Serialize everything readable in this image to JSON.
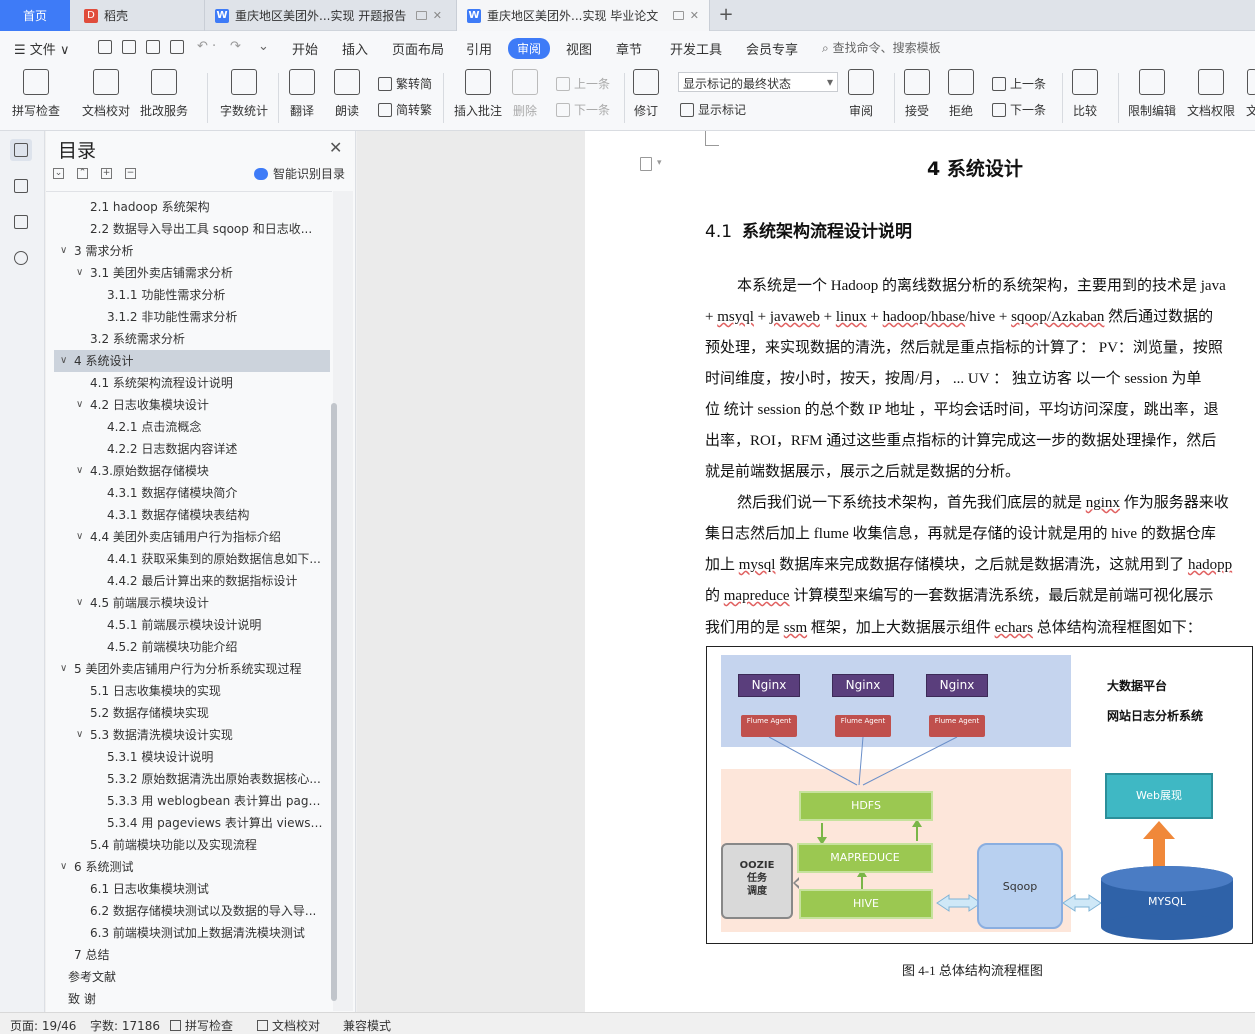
{
  "tabs": {
    "home": "首页",
    "t1": "稻壳",
    "t2": "重庆地区美团外...实现 开题报告",
    "t3": "重庆地区美团外...实现 毕业论文",
    "add": "+"
  },
  "menu": {
    "file": "文件",
    "items": [
      "开始",
      "插入",
      "页面布局",
      "引用",
      "审阅",
      "视图",
      "章节",
      "开发工具",
      "会员专享"
    ],
    "search": "查找命令、搜索模板"
  },
  "ribbon": {
    "spell": "拼写检查",
    "proof": "文档校对",
    "batch": "批改服务",
    "wordcount": "字数统计",
    "translate": "翻译",
    "read": "朗读",
    "trad2simp": "繁转简",
    "simp2trad": "简转繁",
    "insert_comment": "插入批注",
    "delete": "删除",
    "prev1": "上一条",
    "next1": "下一条",
    "track": "修订",
    "markup_state": "显示标记的最终状态",
    "show_markup": "显示标记",
    "review": "审阅",
    "accept": "接受",
    "reject": "拒绝",
    "prev2": "上一条",
    "next2": "下一条",
    "compare": "比较",
    "restrict": "限制编辑",
    "perm": "文档权限",
    "cut": "文"
  },
  "nav": {
    "title": "目录",
    "smart": "智能识别目录",
    "items": [
      {
        "label": "2.1 hadoop 系统架构",
        "lvl": 2,
        "arrow": ""
      },
      {
        "label": "2.2  数据导入导出工具 sqoop 和日志收...",
        "lvl": 2,
        "arrow": ""
      },
      {
        "label": "3  需求分析",
        "lvl": 1,
        "arrow": "∨"
      },
      {
        "label": "3.1  美团外卖店铺需求分析",
        "lvl": 2,
        "arrow": "∨"
      },
      {
        "label": "3.1.1  功能性需求分析",
        "lvl": 3,
        "arrow": ""
      },
      {
        "label": "3.1.2  非功能性需求分析",
        "lvl": 3,
        "arrow": ""
      },
      {
        "label": "3.2  系统需求分析",
        "lvl": 2,
        "arrow": ""
      },
      {
        "label": "4  系统设计",
        "lvl": 1,
        "arrow": "∨"
      },
      {
        "label": "4.1  系统架构流程设计说明",
        "lvl": 2,
        "arrow": ""
      },
      {
        "label": "4.2  日志收集模块设计",
        "lvl": 2,
        "arrow": "∨"
      },
      {
        "label": "4.2.1  点击流概念",
        "lvl": 3,
        "arrow": ""
      },
      {
        "label": "4.2.2  日志数据内容详述",
        "lvl": 3,
        "arrow": ""
      },
      {
        "label": "4.3.原始数据存储模块",
        "lvl": 2,
        "arrow": "∨"
      },
      {
        "label": "4.3.1 数据存储模块简介",
        "lvl": 3,
        "arrow": ""
      },
      {
        "label": "4.3.1  数据存储模块表结构",
        "lvl": 3,
        "arrow": ""
      },
      {
        "label": "4.4  美团外卖店铺用户行为指标介绍",
        "lvl": 2,
        "arrow": "∨"
      },
      {
        "label": "4.4.1  获取采集到的原始数据信息如下...",
        "lvl": 3,
        "arrow": ""
      },
      {
        "label": "4.4.2  最后计算出来的数据指标设计",
        "lvl": 3,
        "arrow": ""
      },
      {
        "label": "4.5  前端展示模块设计",
        "lvl": 2,
        "arrow": "∨"
      },
      {
        "label": "4.5.1  前端展示模块设计说明",
        "lvl": 3,
        "arrow": ""
      },
      {
        "label": "4.5.2  前端模块功能介绍",
        "lvl": 3,
        "arrow": ""
      },
      {
        "label": "5  美团外卖店铺用户行为分析系统实现过程",
        "lvl": 1,
        "arrow": "∨"
      },
      {
        "label": "5.1  日志收集模块的实现",
        "lvl": 2,
        "arrow": ""
      },
      {
        "label": "5.2  数据存储模块实现",
        "lvl": 2,
        "arrow": ""
      },
      {
        "label": "5.3  数据清洗模块设计实现",
        "lvl": 2,
        "arrow": "∨"
      },
      {
        "label": "5.3.1  模块设计说明",
        "lvl": 3,
        "arrow": ""
      },
      {
        "label": "5.3.2 原始数据清洗出原始表数据核心...",
        "lvl": 3,
        "arrow": ""
      },
      {
        "label": "5.3.3  用 weblogbean 表计算出 page...",
        "lvl": 3,
        "arrow": ""
      },
      {
        "label": "5.3.4  用 pageviews 表计算出 views ...",
        "lvl": 3,
        "arrow": ""
      },
      {
        "label": "5.4  前端模块功能以及实现流程",
        "lvl": 2,
        "arrow": ""
      },
      {
        "label": "6  系统测试",
        "lvl": 1,
        "arrow": "∨"
      },
      {
        "label": "6.1 日志收集模块测试",
        "lvl": 2,
        "arrow": ""
      },
      {
        "label": "6.2  数据存储模块测试以及数据的导入导...",
        "lvl": 2,
        "arrow": ""
      },
      {
        "label": "6.3  前端模块测试加上数据清洗模块测试",
        "lvl": 2,
        "arrow": ""
      },
      {
        "label": "7  总结",
        "lvl": 1,
        "arrow": ""
      },
      {
        "label": "参考文献",
        "lvl": 0,
        "arrow": ""
      },
      {
        "label": "致    谢",
        "lvl": 0,
        "arrow": ""
      }
    ],
    "selected": 7
  },
  "doc": {
    "h1": "4  系统设计",
    "h2num": "4.1",
    "h2text": "系统架构流程设计说明",
    "lines": [
      [
        "本系统是一个 Hadoop 的离线数据分析的系统架构，主要用到的技术是  java"
      ],
      [
        "+ ",
        {
          "u": "msyql"
        },
        " + ",
        {
          "u": "javaweb"
        },
        " + ",
        {
          "u": "linux"
        },
        " + ",
        {
          "u": "hadoop/hbase"
        },
        "/hive + ",
        {
          "u": "sqoop/Azkaban"
        },
        " 然后通过数据的"
      ],
      [
        "预处理，来实现数据的清洗，然后就是重点指标的计算了：  PV：浏览量，按照"
      ],
      [
        "时间维度，按小时，按天，按周/月，  ...    UV ：  独立访客    以一个 session 为单"
      ],
      [
        "位  统计 session 的总个数 IP 地址 ，平均会话时间，平均访问深度，跳出率，退"
      ],
      [
        "出率，ROI，RFM  通过这些重点指标的计算完成这一步的数据处理操作，然后"
      ],
      [
        "就是前端数据展示，展示之后就是数据的分析。"
      ],
      [
        "然后我们说一下系统技术架构，首先我们底层的就是 ",
        {
          "u": "nginx"
        },
        " 作为服务器来收"
      ],
      [
        "集日志然后加上 flume 收集信息，再就是存储的设计就是用的 hive 的数据仓库"
      ],
      [
        "加上 ",
        {
          "u": "mysql"
        },
        " 数据库来完成数据存储模块，之后就是数据清洗，这就用到了 ",
        {
          "u": "hadopp"
        }
      ],
      [
        "的 ",
        {
          "u": "mapreduce"
        },
        " 计算模型来编写的一套数据清洗系统，最后就是前端可视化展示"
      ],
      [
        "我们用的是 ",
        {
          "u": "ssm"
        },
        " 框架，加上大数据展示组件 ",
        {
          "u": "echars"
        },
        " 总体结构流程框图如下："
      ]
    ],
    "caption": "图 4-1  总体结构流程框图"
  },
  "figure": {
    "title1": "大数据平台",
    "title2": "网站日志分析系统",
    "nginx": "Nginx",
    "flume": "Flume Agent",
    "hdfs": "HDFS",
    "mapreduce": "MAPREDUCE",
    "hive": "HIVE",
    "oozie1": "OOZIE",
    "oozie2": "任务",
    "oozie3": "调度",
    "sqoop": "Sqoop",
    "web": "Web展现",
    "mysql": "MYSQL"
  },
  "status": {
    "page": "页面: 19/46",
    "words": "字数: 17186",
    "spell": "拼写检查",
    "proof": "文档校对",
    "compat": "兼容模式"
  }
}
